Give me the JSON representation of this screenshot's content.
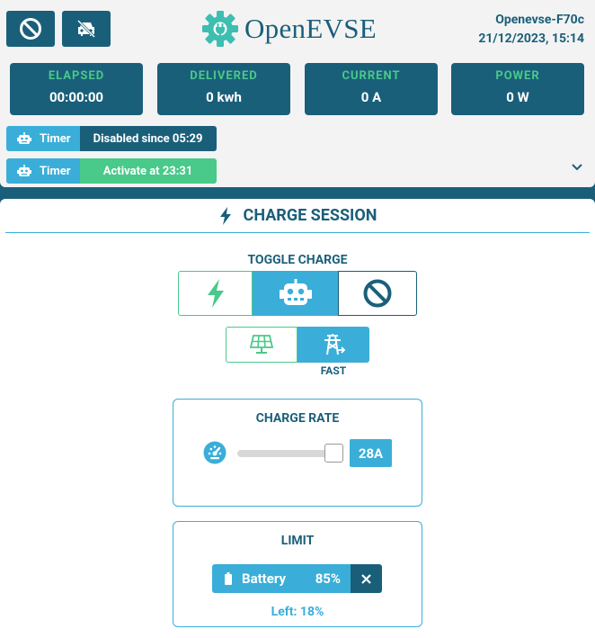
{
  "header": {
    "logo_text": "OpenEVSE",
    "device_name": "Openevse-F70c",
    "datetime": "21/12/2023, 15:14"
  },
  "stats": [
    {
      "label": "ELAPSED",
      "value": "00:00:00"
    },
    {
      "label": "DELIVERED",
      "value": "0 kwh"
    },
    {
      "label": "CURRENT",
      "value": "0 A"
    },
    {
      "label": "POWER",
      "value": "0 W"
    }
  ],
  "timers": [
    {
      "label": "Timer",
      "status": "Disabled since 05:29",
      "status_color": "#1a5f7a"
    },
    {
      "label": "Timer",
      "status": "Activate at 23:31",
      "status_color": "#49c98a"
    }
  ],
  "session": {
    "title": "CHARGE SESSION",
    "toggle_label": "TOGGLE CHARGE",
    "mode_caption": "FAST",
    "charge_rate": {
      "title": "CHARGE RATE",
      "value_label": "28A"
    },
    "limit": {
      "title": "LIMIT",
      "type": "Battery",
      "value": "85%",
      "left_text": "Left: 18%"
    }
  },
  "colors": {
    "primary": "#1a5f7a",
    "accent": "#3aaed8",
    "green": "#49c98a"
  }
}
